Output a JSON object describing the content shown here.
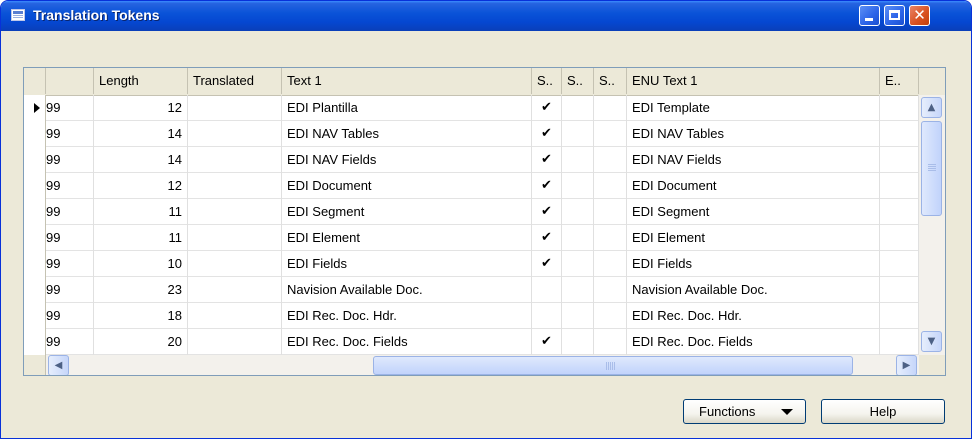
{
  "window": {
    "title": "Translation Tokens"
  },
  "table": {
    "columns": [
      "Length",
      "Translated",
      "Text 1",
      "S..",
      "S..",
      "S..",
      "ENU Text 1",
      "E.."
    ],
    "rows": [
      {
        "id": "99",
        "length": "12",
        "translated": "",
        "text1": "EDI Plantilla",
        "s1": "✔",
        "s2": "",
        "s3": "",
        "enu": "EDI Template"
      },
      {
        "id": "99",
        "length": "14",
        "translated": "",
        "text1": "EDI NAV Tables",
        "s1": "✔",
        "s2": "",
        "s3": "",
        "enu": "EDI NAV Tables"
      },
      {
        "id": "99",
        "length": "14",
        "translated": "",
        "text1": "EDI NAV Fields",
        "s1": "✔",
        "s2": "",
        "s3": "",
        "enu": "EDI NAV Fields"
      },
      {
        "id": "99",
        "length": "12",
        "translated": "",
        "text1": "EDI Document",
        "s1": "✔",
        "s2": "",
        "s3": "",
        "enu": "EDI Document"
      },
      {
        "id": "99",
        "length": "11",
        "translated": "",
        "text1": "EDI Segment",
        "s1": "✔",
        "s2": "",
        "s3": "",
        "enu": "EDI Segment"
      },
      {
        "id": "99",
        "length": "11",
        "translated": "",
        "text1": "EDI Element",
        "s1": "✔",
        "s2": "",
        "s3": "",
        "enu": "EDI Element"
      },
      {
        "id": "99",
        "length": "10",
        "translated": "",
        "text1": "EDI Fields",
        "s1": "✔",
        "s2": "",
        "s3": "",
        "enu": "EDI Fields"
      },
      {
        "id": "99",
        "length": "23",
        "translated": "",
        "text1": "Navision Available Doc.",
        "s1": "",
        "s2": "",
        "s3": "",
        "enu": "Navision Available Doc."
      },
      {
        "id": "99",
        "length": "18",
        "translated": "",
        "text1": "EDI Rec. Doc. Hdr.",
        "s1": "",
        "s2": "",
        "s3": "",
        "enu": "EDI Rec. Doc. Hdr."
      },
      {
        "id": "99",
        "length": "20",
        "translated": "",
        "text1": "EDI Rec. Doc. Fields",
        "s1": "✔",
        "s2": "",
        "s3": "",
        "enu": "EDI Rec. Doc. Fields"
      }
    ]
  },
  "buttons": {
    "functions": "Functions",
    "help": "Help"
  },
  "icons": {
    "window": "table-icon",
    "minimize": "minimize-icon",
    "maximize": "maximize-icon",
    "close": "close-icon",
    "close_glyph": "✕"
  }
}
